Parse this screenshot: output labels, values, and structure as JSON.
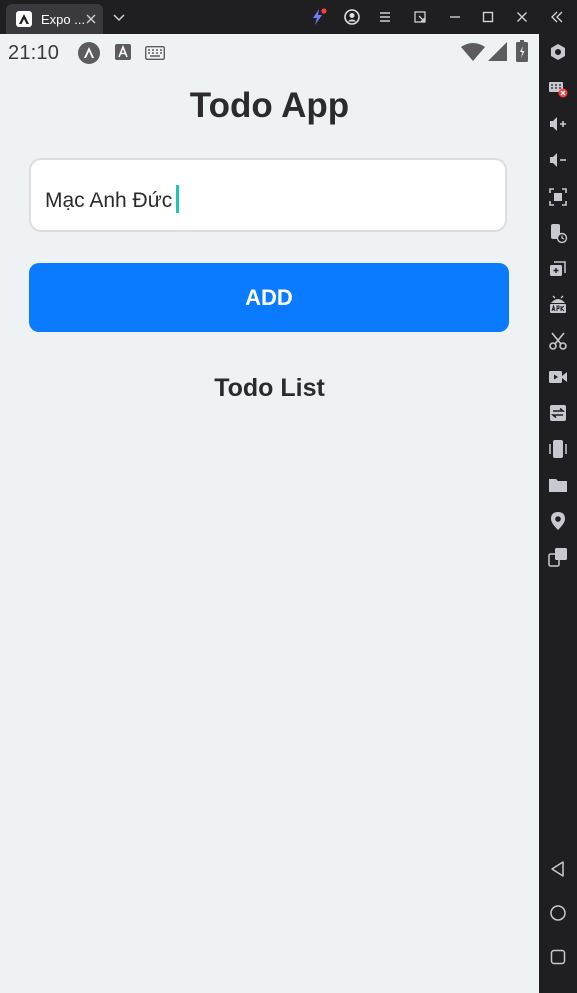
{
  "window": {
    "tab_title": "Expo ...",
    "accent_color": "#0a7bff",
    "caret_color": "#1ec8b0"
  },
  "title_bar_icons": [
    "lightning-icon",
    "account-icon",
    "menu-icon",
    "pin-window-icon",
    "minimize-icon",
    "maximize-icon",
    "close-icon",
    "collapse-sidebar-icon"
  ],
  "status_bar": {
    "time": "21:10",
    "icons": [
      "expo-icon",
      "font-icon",
      "keyboard-icon",
      "wifi-icon",
      "signal-icon",
      "battery-icon"
    ]
  },
  "app": {
    "title": "Todo App",
    "input": {
      "value": "Mạc Anh Đức",
      "placeholder": ""
    },
    "add_button_label": "ADD",
    "list_title": "Todo List",
    "todos": []
  },
  "emulator_sidebar": {
    "icons": [
      "settings-hex-icon",
      "keyboard-off-icon",
      "volume-up-icon",
      "volume-down-icon",
      "screenshot-icon",
      "rotate-icon",
      "multi-window-icon",
      "apk-install-icon",
      "scissors-icon",
      "video-record-icon",
      "swap-icon",
      "shake-icon",
      "folder-icon",
      "location-icon",
      "multi-instance-icon",
      "back-icon",
      "home-icon",
      "recents-icon"
    ]
  }
}
